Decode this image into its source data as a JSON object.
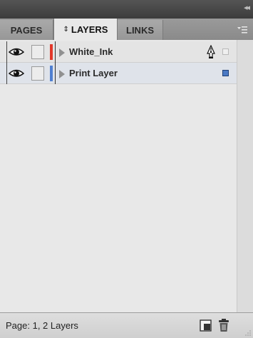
{
  "tabs": [
    {
      "label": "PAGES",
      "active": false
    },
    {
      "label": "LAYERS",
      "active": true,
      "prefix_icon": "sort-arrows-icon"
    },
    {
      "label": "LINKS",
      "active": false
    }
  ],
  "panel_menu_icon": "panel-menu-icon",
  "collapse_icon_text": "◂◂",
  "layers": [
    {
      "name": "White_Ink",
      "color": "#e2382a",
      "visible": true,
      "locked": false,
      "has_pen_icon": true,
      "selected": false
    },
    {
      "name": "Print Layer",
      "color": "#4f7fd1",
      "visible": true,
      "locked": false,
      "has_pen_icon": false,
      "selected": true
    }
  ],
  "footer": {
    "status": "Page: 1, 2 Layers",
    "new_layer_icon": "new-layer-icon",
    "delete_icon": "trash-icon"
  }
}
